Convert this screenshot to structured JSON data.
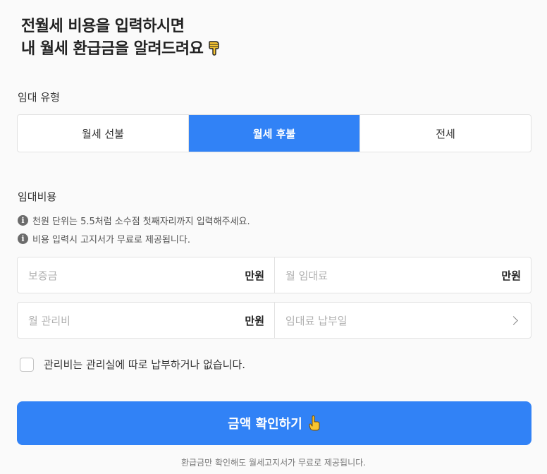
{
  "headline": {
    "line1": "전월세 비용을 입력하시면",
    "line2": "내 월세 환급금을 알려드려요"
  },
  "rent_type": {
    "label": "임대 유형",
    "options": [
      "월세 선불",
      "월세 후불",
      "전세"
    ],
    "selected": "월세 후불"
  },
  "costs": {
    "label": "임대비용",
    "notes": [
      "천원 단위는 5.5처럼 소수점 첫째자리까지 입력해주세요.",
      "비용 입력시 고지서가 무료로 제공됩니다."
    ],
    "deposit": {
      "placeholder": "보증금",
      "unit": "만원"
    },
    "monthly_rent": {
      "placeholder": "월 임대료",
      "unit": "만원"
    },
    "maintenance_fee": {
      "placeholder": "월 관리비",
      "unit": "만원"
    },
    "payment_day": {
      "placeholder": "임대료 납부일"
    }
  },
  "checkbox": {
    "label": "관리비는 관리실에 따로 납부하거나 없습니다.",
    "checked": false
  },
  "cta": {
    "label": "금액 확인하기"
  },
  "footer_note": "환급금만 확인해도 월세고지서가 무료로 제공됩니다.",
  "colors": {
    "accent": "#3182f6",
    "background": "#fafafa"
  }
}
